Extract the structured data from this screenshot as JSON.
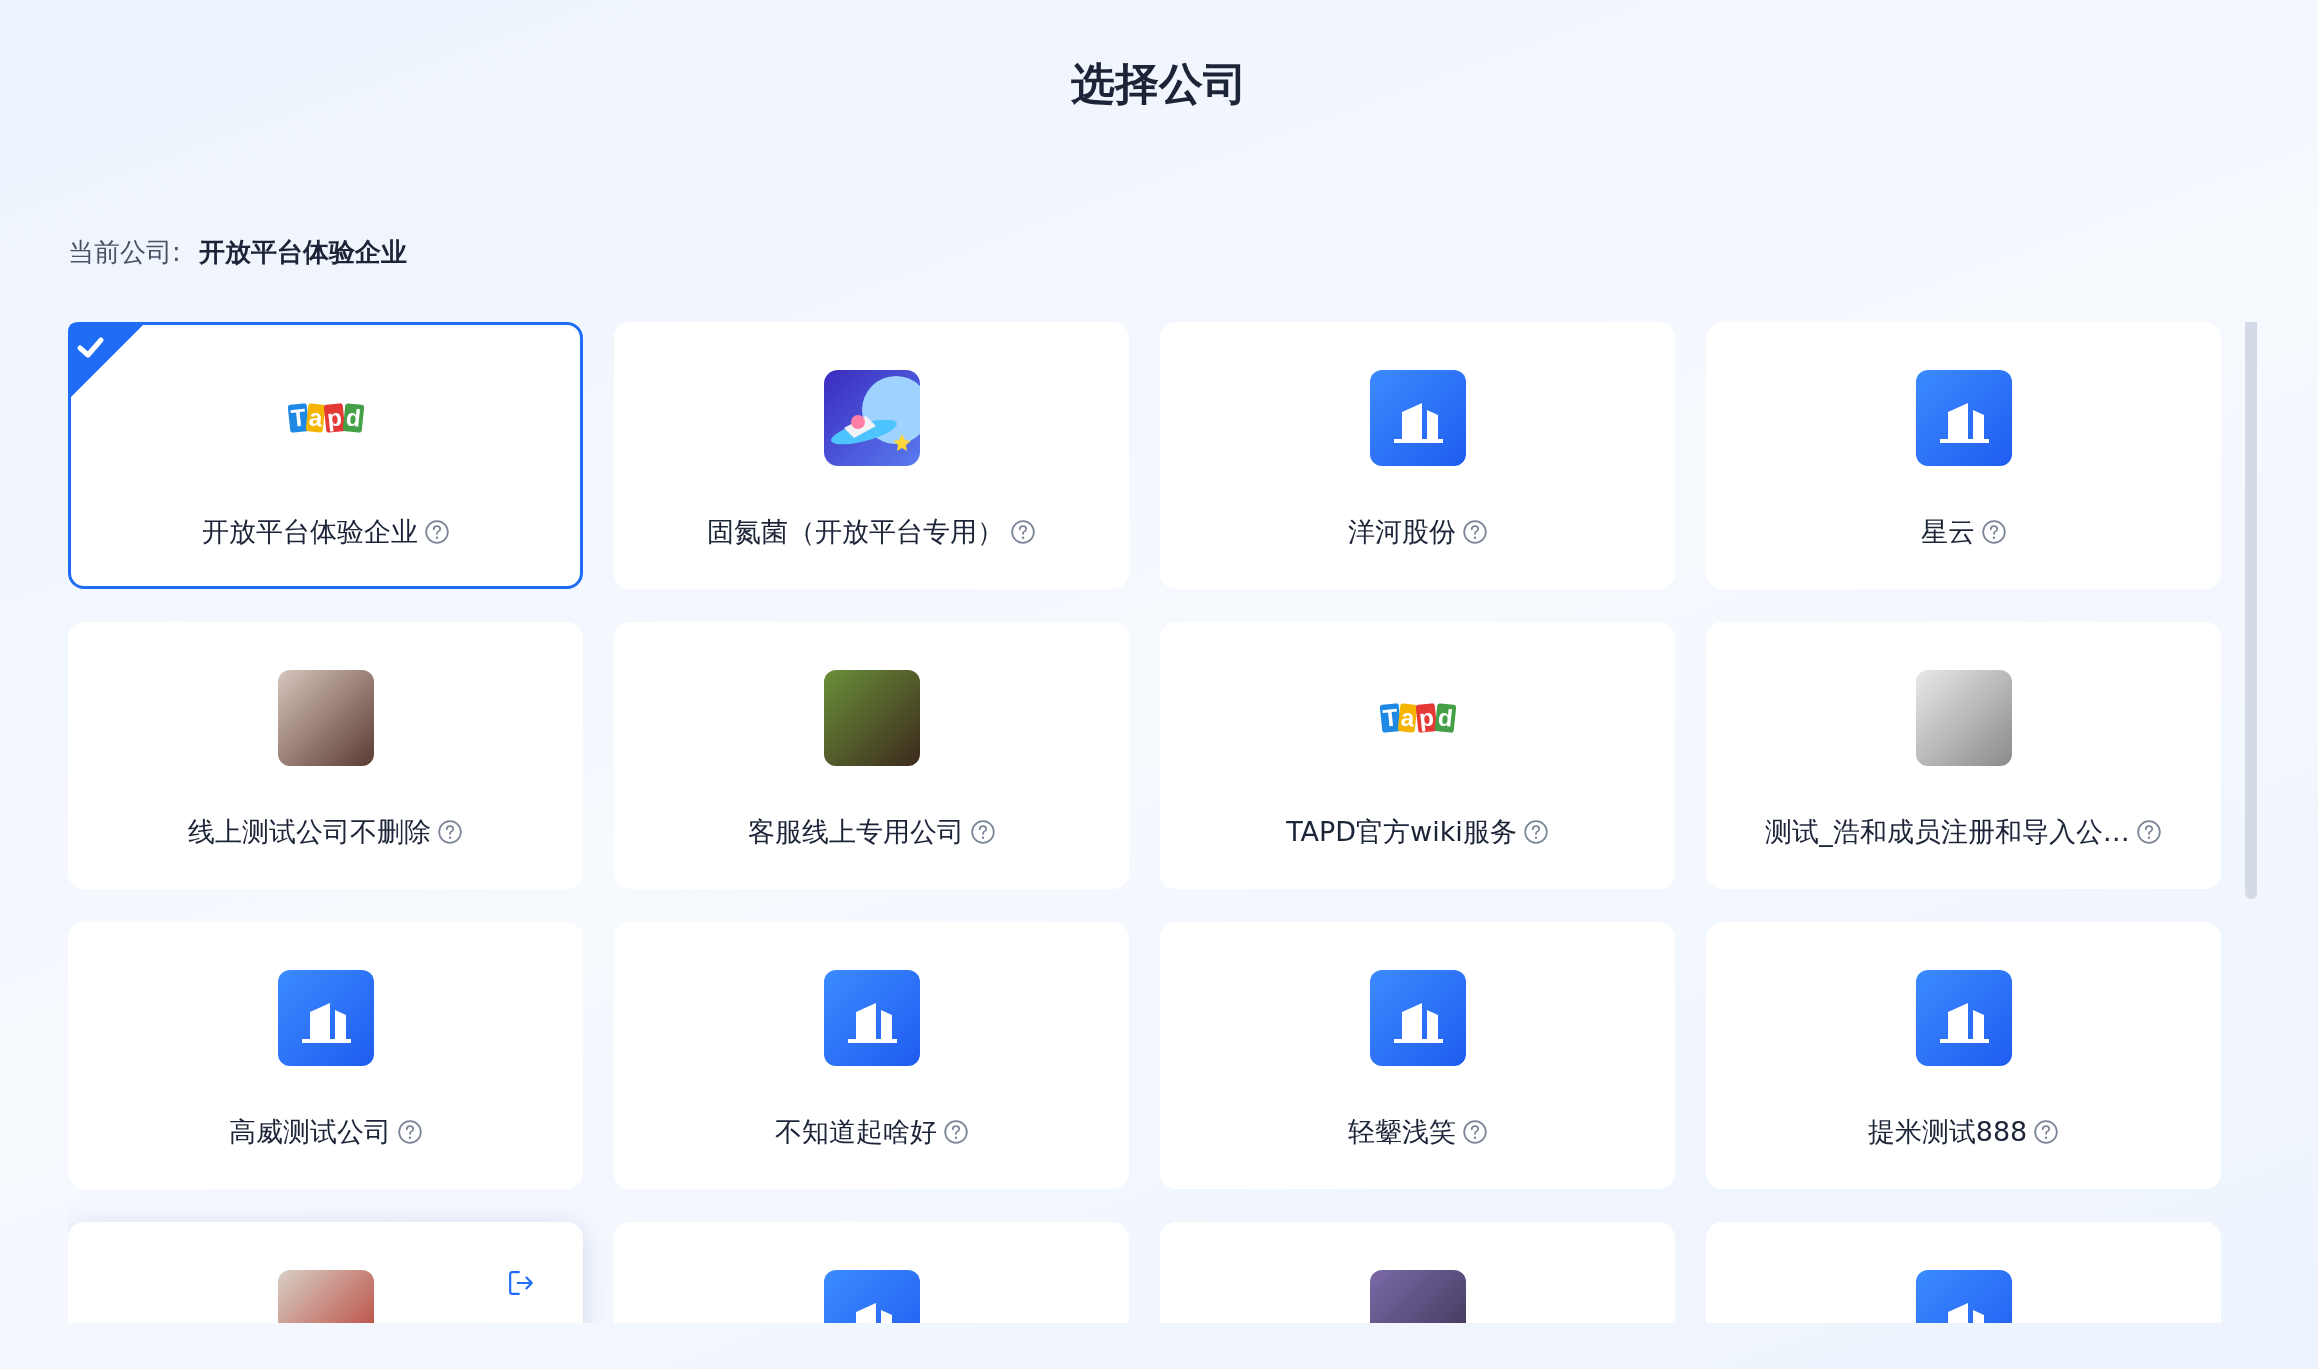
{
  "page": {
    "title": "选择公司"
  },
  "current_company": {
    "label": "当前公司:",
    "value": "开放平台体验企业"
  },
  "companies": [
    {
      "name": "开放平台体验企业",
      "kind": "tapd",
      "logo_text": "Tapd",
      "selected": true,
      "hovered": false
    },
    {
      "name": "固氮菌（开放平台专用）",
      "kind": "artwork",
      "selected": false,
      "hovered": false
    },
    {
      "name": "洋河股份",
      "kind": "building",
      "selected": false,
      "hovered": false
    },
    {
      "name": "星云",
      "kind": "building",
      "selected": false,
      "hovered": false
    },
    {
      "name": "线上测试公司不删除",
      "kind": "photo",
      "selected": false,
      "hovered": false
    },
    {
      "name": "客服线上专用公司",
      "kind": "photo",
      "selected": false,
      "hovered": false
    },
    {
      "name": "TAPD官方wiki服务",
      "kind": "tapd",
      "logo_text": "Tapd",
      "selected": false,
      "hovered": false
    },
    {
      "name": "测试_浩和成员注册和导入公…",
      "kind": "photo",
      "selected": false,
      "hovered": false
    },
    {
      "name": "高威测试公司",
      "kind": "building",
      "selected": false,
      "hovered": false
    },
    {
      "name": "不知道起啥好",
      "kind": "building",
      "selected": false,
      "hovered": false
    },
    {
      "name": "轻颦浅笑",
      "kind": "building",
      "selected": false,
      "hovered": false
    },
    {
      "name": "提米测试888",
      "kind": "building",
      "selected": false,
      "hovered": false
    },
    {
      "kind": "photo",
      "selected": false,
      "hovered": true
    },
    {
      "kind": "building",
      "selected": false,
      "hovered": false
    },
    {
      "kind": "photo",
      "selected": false,
      "hovered": false
    },
    {
      "kind": "building",
      "selected": false,
      "hovered": false
    }
  ]
}
